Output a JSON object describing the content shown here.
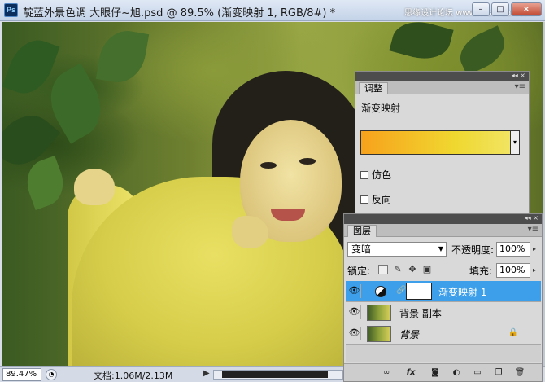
{
  "window": {
    "app_icon": "Ps",
    "title": "靛蓝外景色调 大眼仔~旭.psd @ 89.5% (渐变映射 1, RGB/8#) *",
    "watermark": "思缘设计论坛 www.missvuan.com",
    "minimize": "–",
    "maximize": "□",
    "close": "×"
  },
  "status_bar": {
    "zoom": "89.47%",
    "doc_info": "文档:1.06M/2.13M",
    "arrow": "▶"
  },
  "adjustments_panel": {
    "collapse": "◂◂",
    "close": "×",
    "tab": "调整",
    "menu": "▾≡",
    "title": "渐变映射",
    "gradient_dropdown": "▾",
    "options": [
      {
        "label": "仿色",
        "checked": false
      },
      {
        "label": "反向",
        "checked": false
      }
    ],
    "gradient_colors": [
      "#f7a21c",
      "#f0d830",
      "#f1e66a"
    ]
  },
  "layers_panel": {
    "collapse": "◂◂",
    "close": "×",
    "tab": "图层",
    "menu": "▾≡",
    "blend_mode": "变暗",
    "opacity_label": "不透明度:",
    "opacity_value": "100%",
    "lock_label": "锁定:",
    "fill_label": "填充:",
    "fill_value": "100%",
    "layers": [
      {
        "name": "渐变映射 1",
        "selected": true,
        "visible": true
      },
      {
        "name": "背景 副本",
        "selected": false,
        "visible": true
      },
      {
        "name": "背景",
        "selected": false,
        "visible": true,
        "locked": true
      }
    ],
    "selection_color": "#3d9fe9"
  }
}
